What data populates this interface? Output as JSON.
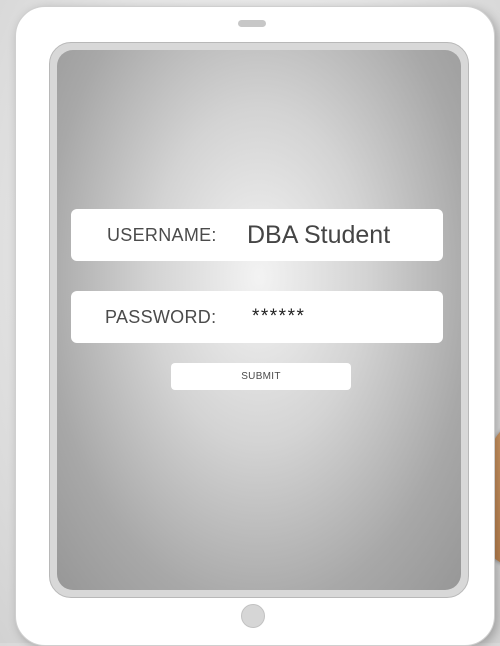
{
  "login": {
    "username_label": "USERNAME:",
    "username_value": "DBA Student",
    "password_label": "PASSWORD:",
    "password_value": "******",
    "submit_label": "SUBMIT"
  },
  "colors": {
    "tablet_body": "#ffffff",
    "screen_center": "#f3f3f3",
    "screen_edge": "#979797",
    "field_background": "#ffffff",
    "thumb": "#c48b58"
  }
}
